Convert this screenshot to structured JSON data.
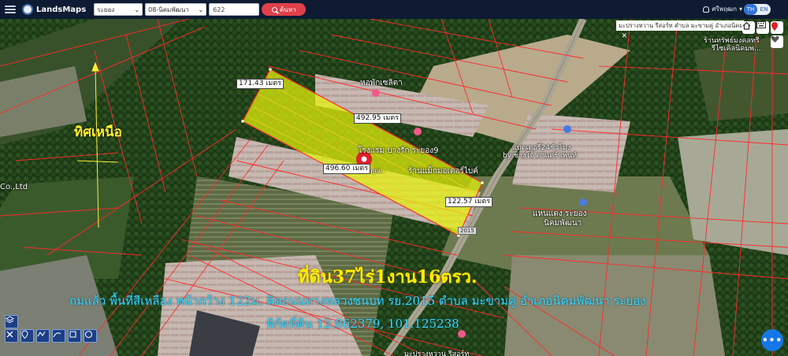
{
  "app": {
    "name": "LandsMaps"
  },
  "toolbar": {
    "province": "ระยอง",
    "district": "08-นิคมพัฒนา",
    "parcel_value": "622",
    "search_label": "ค้นหา",
    "user_label": "ศรีพฤฒก",
    "lang_th": "TH",
    "lang_en": "EN"
  },
  "info_bar": {
    "text": "มะปรางหวาน รีสอร์ท ตำบล มะขามคู่ อำเภอนิคม"
  },
  "map": {
    "distances": {
      "top": "171.43 เมตร",
      "upper": "492.95 เมตร",
      "lower": "496.60 เมตร",
      "right": "122.57 เมตร"
    },
    "places": {
      "dorm": "หอพักเซลิตา",
      "hotel": "โรงแรม บางรัก ระยอง9",
      "shop1": "ร้านแม็กมอเตอร์ไบค์",
      "battery": "แบตเตอรี่24ชั่วโมง",
      "battery_sub": "by ช่างโจ้ คาแคร์ เพนท์",
      "rental": "แหนแดง ระยอง",
      "rental_sub": "นิคมพัฒนา",
      "shop_top": "ร้านทรัพย์มงคลทรี",
      "shop_top_sub": "รีไซเคิลนิคมพ...",
      "co": "Co.,Ltd",
      "bottom_resort": "มะปรางหวาน รีสอร์ท",
      "pin_note": "คุณ.."
    },
    "road_label": "2015",
    "north_label": "ทิศเหนือ",
    "headline": "ที่ดิน37ไร่1งาน16ตรว.",
    "desc_line": "ถมแล้ว พื้นที่สีเหลือง หน้ากว้าง 122ม. ติดถนนทางหลวงชนบท รย.2015 ตำบล มะขามคู่ อำเภอนิคมพัฒนา ระยอง",
    "coords_line": "พิกัดที่ดิน 12.862379, 101.125238"
  },
  "colors": {
    "parcel_fill": "#e6f20a",
    "parcel_line": "#ff2a2a",
    "pin": "#e0202a",
    "accent": "#1677e8"
  },
  "fab_label": "•••"
}
